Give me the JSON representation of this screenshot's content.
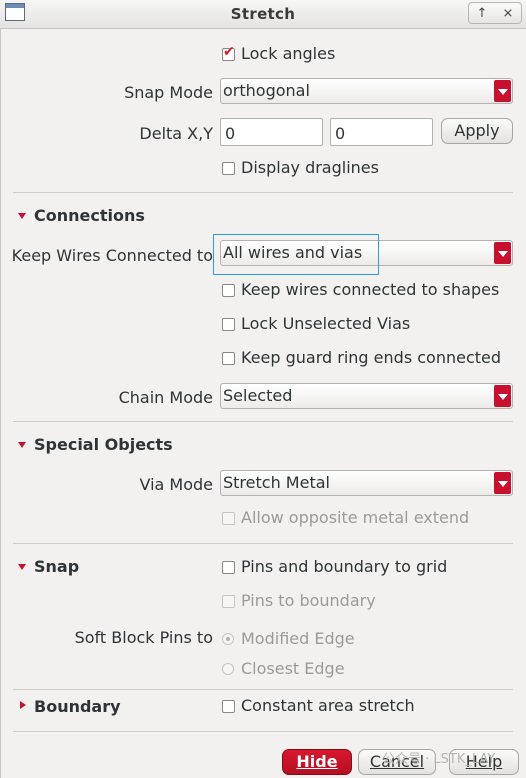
{
  "window": {
    "title": "Stretch",
    "controls": [
      "↑",
      "⨯"
    ]
  },
  "lock_angles": {
    "label": "Lock angles",
    "checked": true
  },
  "snap_mode": {
    "label": "Snap Mode",
    "value": "orthogonal"
  },
  "delta": {
    "label": "Delta X,Y",
    "x": "0",
    "y": "0",
    "apply_label": "Apply"
  },
  "display_draglines": {
    "label": "Display draglines",
    "checked": false
  },
  "connections": {
    "title": "Connections",
    "keep_wires": {
      "label": "Keep Wires Connected to",
      "value": "All wires and vias"
    },
    "keep_shapes": {
      "label": "Keep wires connected to shapes",
      "checked": false
    },
    "lock_vias": {
      "label": "Lock Unselected Vias",
      "checked": false
    },
    "guard_ring": {
      "label": "Keep guard ring ends connected",
      "checked": false
    },
    "chain_mode": {
      "label": "Chain Mode",
      "value": "Selected"
    }
  },
  "special_objects": {
    "title": "Special Objects",
    "via_mode": {
      "label": "Via Mode",
      "value": "Stretch Metal"
    },
    "allow_opposite": {
      "label": "Allow opposite metal extend",
      "checked": false,
      "enabled": false
    }
  },
  "snap": {
    "title": "Snap",
    "pins_grid": {
      "label": "Pins and boundary to grid",
      "checked": false
    },
    "pins_boundary": {
      "label": "Pins to boundary",
      "checked": false,
      "enabled": false
    },
    "soft_block": {
      "label": "Soft Block Pins to",
      "options": [
        "Modified Edge",
        "Closest Edge"
      ],
      "selected": "Modified Edge"
    }
  },
  "boundary": {
    "title": "Boundary",
    "constant_area": {
      "label": "Constant area stretch",
      "checked": false
    }
  },
  "footer": {
    "hide": "Hide",
    "cancel": "Cancel",
    "help": "Help"
  },
  "watermark": "公众号 · LSTK_LAY",
  "colors": {
    "accent": "#c8102e",
    "focus": "#2b9fd9",
    "background": "#f2f1f0"
  }
}
